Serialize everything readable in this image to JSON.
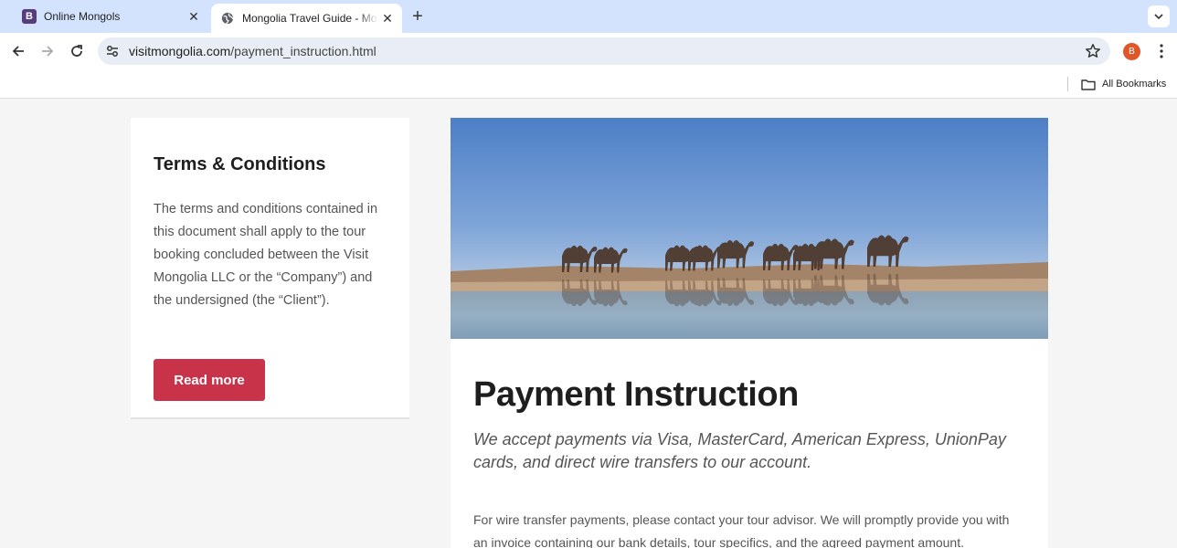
{
  "browser": {
    "tabs": [
      {
        "title": "Online Mongols",
        "favicon": "bootstrap-b",
        "favicon_letter": "B",
        "active": false
      },
      {
        "title": "Mongolia Travel Guide - Mongolia",
        "favicon": "globe-icon",
        "active": true
      }
    ],
    "url": {
      "domain": "visitmongolia.com",
      "path": "/payment_instruction.html"
    },
    "profile_initial": "B",
    "profile_color": "#e0562b",
    "bookmarks": {
      "all_bookmarks_label": "All Bookmarks"
    }
  },
  "sidebar": {
    "heading": "Terms & Conditions",
    "text": "The terms and conditions contained in this document shall apply to the tour booking concluded between the Visit Mongolia LLC or the “Company”) and the undersigned (the “Client”).",
    "button_label": "Read more",
    "button_color": "#c8334a"
  },
  "main": {
    "hero_image": "camels-by-lake-photo",
    "title": "Payment Instruction",
    "lead": "We accept payments via Visa, MasterCard, American Express, UnionPay cards, and direct wire transfers to our account.",
    "body": "For wire transfer payments, please contact your tour advisor. We will promptly provide you with an invoice containing our bank details, tour specifics, and the agreed payment amount."
  }
}
